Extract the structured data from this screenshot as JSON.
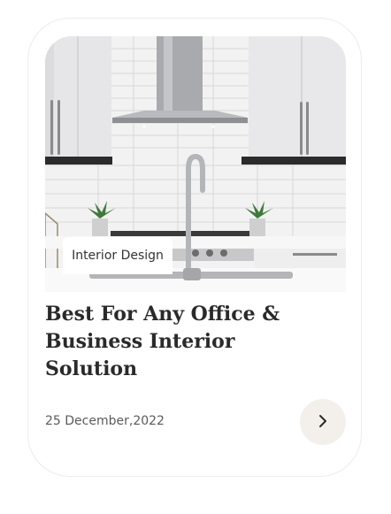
{
  "card": {
    "category_tag": "Interior Design",
    "title": "Best For Any Office & Business Interior Solution",
    "date": "25 December,2022",
    "next_button_icon": "chevron-right-icon"
  },
  "colors": {
    "title": "#2a2a2a",
    "button_bg": "#f3f0ec",
    "card_border": "#ececec"
  }
}
